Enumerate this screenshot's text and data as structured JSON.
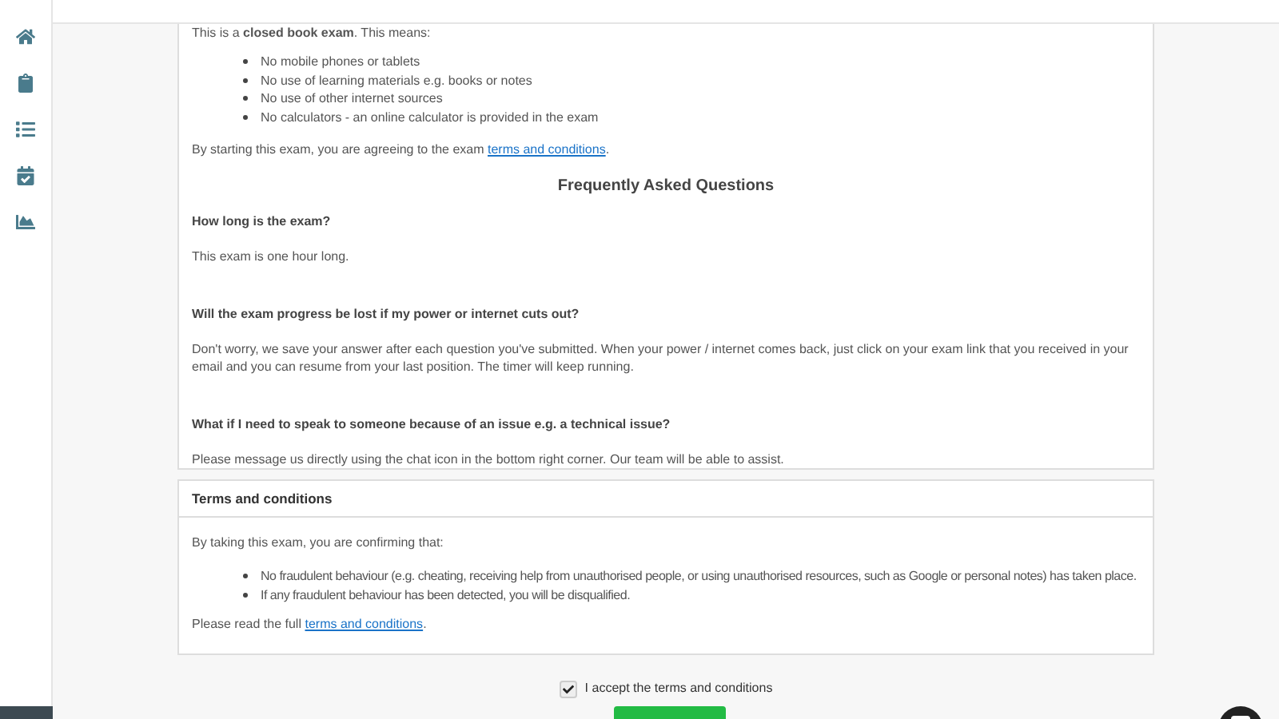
{
  "intro": {
    "text": "This is a **closed book exam**. This means:",
    "bullets": [
      "No mobile phones or tablets",
      "No use of learning materials e.g. books or notes",
      "No use of other internet sources",
      "No calculators - an online calculator is provided in the exam"
    ],
    "agree_text": "By starting this exam, you are agreeing to the exam",
    "agree_link": "terms and conditions",
    "agree_end": "."
  },
  "faq": {
    "title": "Frequently Asked Questions",
    "items": [
      {
        "question": "How long is the exam?",
        "answer": "This exam is one hour long."
      },
      {
        "question": "Will the exam progress be lost if my power or internet cuts out?",
        "answer": "Don't worry, we save your answer after each question you've submitted. When your power / internet comes back, just click on your exam link that you received in your email and you can resume from your last position. The timer will keep running."
      },
      {
        "question": "What if I need to speak to someone because of an issue e.g. a technical issue?",
        "answer": "Please message us directly using the chat icon in the bottom right corner. Our team will be able to assist."
      }
    ]
  },
  "terms": {
    "title": "Terms and conditions",
    "intro": "By taking this exam, you are confirming that:",
    "bullets": [
      "No fraudulent behaviour (e.g. cheating, receiving help from unauthorised people, or using unauthorised resources, such as Google or personal notes) has taken place.",
      "If any fraudulent behaviour has been detected, you will be disqualified."
    ],
    "read_text": "Please read the full",
    "read_link": "terms and conditions",
    "read_end": "."
  },
  "accept": {
    "label": "I accept the terms and conditions",
    "checked": true
  }
}
